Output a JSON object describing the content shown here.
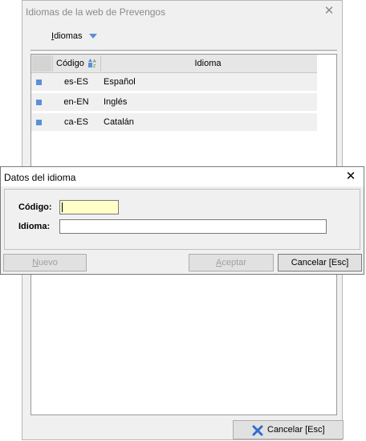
{
  "bg_window": {
    "title": "Idiomas de la web de Prevengos",
    "close_glyph": "✕",
    "menu_label_u": "I",
    "menu_label_rest": "diomas",
    "grid": {
      "col_code": "Código",
      "col_name": "Idioma",
      "rows": [
        {
          "code": "es-ES",
          "name": "Español"
        },
        {
          "code": "en-EN",
          "name": "Inglés"
        },
        {
          "code": "ca-ES",
          "name": "Catalán"
        }
      ]
    },
    "cancel_label": "Cancelar [Esc]"
  },
  "dialog": {
    "title": "Datos del idioma",
    "close_glyph": "✕",
    "code_label": "Código:",
    "code_value": "",
    "name_label": "Idioma:",
    "name_value": "",
    "btn_new_u": "N",
    "btn_new_rest": "uevo",
    "btn_accept_u": "A",
    "btn_accept_rest": "ceptar",
    "btn_cancel": "Cancelar [Esc]"
  },
  "colors": {
    "accent_blue": "#5b8fd6",
    "code_field_bg": "#ffffc8",
    "cancel_icon": "#2f6fd0"
  }
}
